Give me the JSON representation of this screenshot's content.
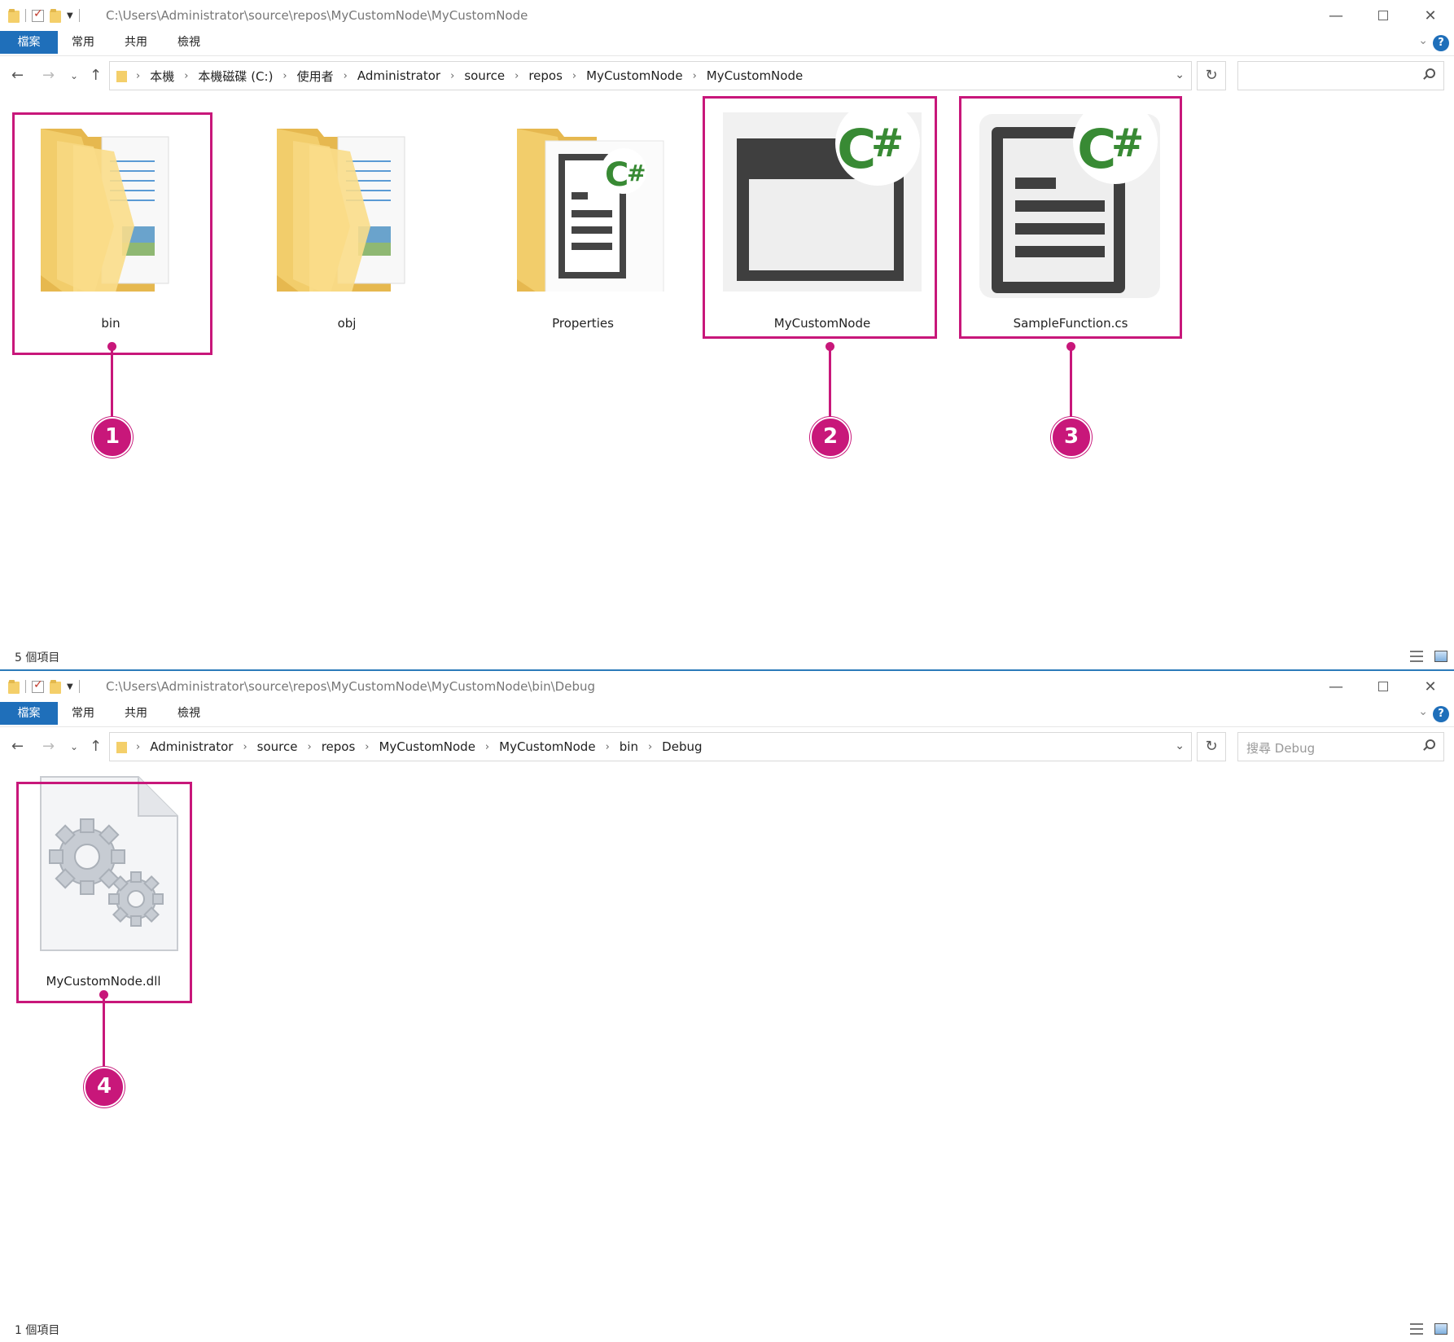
{
  "windows": [
    {
      "title_path": "C:\\Users\\Administrator\\source\\repos\\MyCustomNode\\MyCustomNode",
      "ribbon": {
        "file": "檔案",
        "home": "常用",
        "share": "共用",
        "view": "檢視"
      },
      "breadcrumbs": [
        "本機",
        "本機磁碟 (C:)",
        "使用者",
        "Administrator",
        "source",
        "repos",
        "MyCustomNode",
        "MyCustomNode"
      ],
      "search_placeholder": "",
      "items": [
        {
          "label": "bin",
          "icon": "folder-icon"
        },
        {
          "label": "obj",
          "icon": "folder-icon"
        },
        {
          "label": "Properties",
          "icon": "folder-csharp-icon"
        },
        {
          "label": "MyCustomNode",
          "icon": "csharp-project-icon"
        },
        {
          "label": "SampleFunction.cs",
          "icon": "csharp-file-icon"
        }
      ],
      "status": "5 個項目"
    },
    {
      "title_path": "C:\\Users\\Administrator\\source\\repos\\MyCustomNode\\MyCustomNode\\bin\\Debug",
      "ribbon": {
        "file": "檔案",
        "home": "常用",
        "share": "共用",
        "view": "檢視"
      },
      "breadcrumbs": [
        "Administrator",
        "source",
        "repos",
        "MyCustomNode",
        "MyCustomNode",
        "bin",
        "Debug"
      ],
      "search_placeholder": "搜尋 Debug",
      "items": [
        {
          "label": "MyCustomNode.dll",
          "icon": "dll-gears-icon"
        }
      ],
      "status": "1 個項目"
    }
  ],
  "callouts": [
    "1",
    "2",
    "3",
    "4"
  ],
  "icons": {
    "back": "←",
    "forward": "→",
    "up": "↑",
    "refresh": "↻",
    "chevron": "›",
    "dropdown": "⌄",
    "minimize": "—",
    "close": "✕",
    "help": "?"
  },
  "colors": {
    "highlight": "#c8177a",
    "ribbon_file": "#1f6fba",
    "csharp_green": "#388a34"
  }
}
